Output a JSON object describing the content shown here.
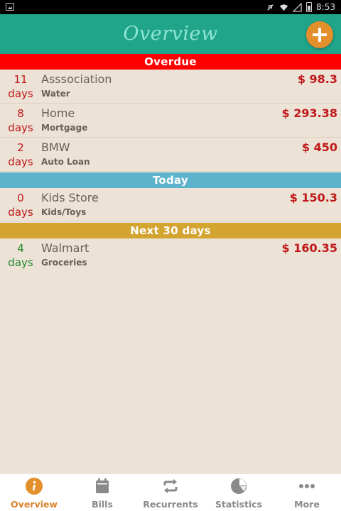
{
  "status_bar": {
    "time": "8:53"
  },
  "app_bar": {
    "title": "Overview",
    "add_button": "+"
  },
  "sections": [
    {
      "label": "Overdue",
      "color": "#ff0000"
    },
    {
      "label": "Today",
      "color": "#5eb3cc"
    },
    {
      "label": "Next 30 days",
      "color": "#d4a430"
    }
  ],
  "bills": [
    {
      "days": "11",
      "unit": "days",
      "name": "Asssociation",
      "category": "Water",
      "amount": "$ 98.3",
      "days_color": "red"
    },
    {
      "days": "8",
      "unit": "days",
      "name": "Home",
      "category": "Mortgage",
      "amount": "$ 293.38",
      "days_color": "red"
    },
    {
      "days": "2",
      "unit": "days",
      "name": "BMW",
      "category": "Auto Loan",
      "amount": "$ 450",
      "days_color": "red"
    },
    {
      "days": "0",
      "unit": "days",
      "name": "Kids Store",
      "category": "Kids/Toys",
      "amount": "$ 150.3",
      "days_color": "red"
    },
    {
      "days": "4",
      "unit": "days",
      "name": "Walmart",
      "category": "Groceries",
      "amount": "$ 160.35",
      "days_color": "green"
    }
  ],
  "tabs": [
    {
      "label": "Overview",
      "icon": "info-icon",
      "active": true
    },
    {
      "label": "Bills",
      "icon": "calendar-icon",
      "active": false
    },
    {
      "label": "Recurrents",
      "icon": "repeat-icon",
      "active": false
    },
    {
      "label": "Statistics",
      "icon": "pie-chart-icon",
      "active": false
    },
    {
      "label": "More",
      "icon": "more-dots-icon",
      "active": false
    }
  ]
}
